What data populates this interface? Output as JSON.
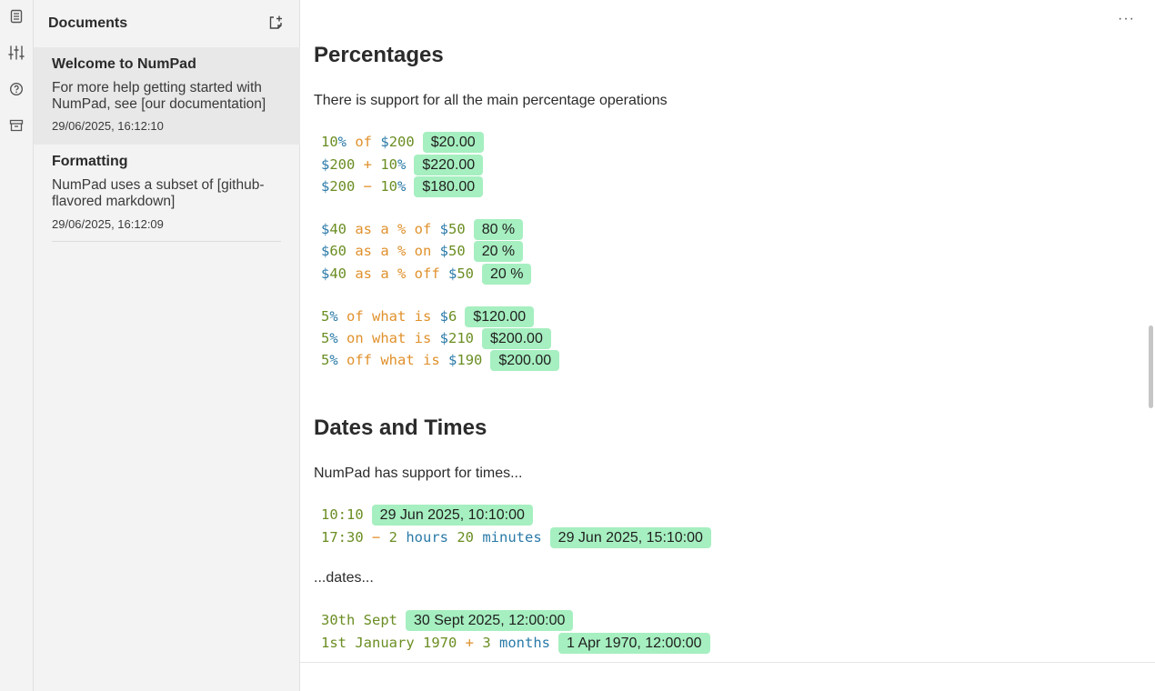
{
  "sidebar": {
    "title": "Documents",
    "documents": [
      {
        "title": "Welcome to NumPad",
        "preview": "For more help getting started with NumPad, see [our documentation]",
        "date": "29/06/2025, 16:12:10"
      },
      {
        "title": "Formatting",
        "preview": "NumPad uses a subset of [github-flavored markdown]",
        "date": "29/06/2025, 16:12:09"
      }
    ]
  },
  "rail_icons": [
    "document-icon",
    "sliders-icon",
    "help-icon",
    "archive-icon"
  ],
  "editor": {
    "more_label": "···",
    "sections": [
      {
        "heading": "Percentages",
        "intro": "There is support for all the main percentage operations",
        "lines": [
          {
            "tokens": [
              [
                "num",
                "10"
              ],
              [
                "unit",
                "%"
              ],
              [
                "kw",
                " of "
              ],
              [
                "unit",
                "$"
              ],
              [
                "num",
                "200"
              ]
            ],
            "result": "$20.00"
          },
          {
            "tokens": [
              [
                "unit",
                "$"
              ],
              [
                "num",
                "200"
              ],
              [
                "op",
                " + "
              ],
              [
                "num",
                "10"
              ],
              [
                "unit",
                "%"
              ]
            ],
            "result": "$220.00"
          },
          {
            "tokens": [
              [
                "unit",
                "$"
              ],
              [
                "num",
                "200"
              ],
              [
                "op",
                " − "
              ],
              [
                "num",
                "10"
              ],
              [
                "unit",
                "%"
              ]
            ],
            "result": "$180.00"
          },
          {
            "tokens": [
              [
                "unit",
                "$"
              ],
              [
                "num",
                "40"
              ],
              [
                "kw",
                " as a % of "
              ],
              [
                "unit",
                "$"
              ],
              [
                "num",
                "50"
              ]
            ],
            "result": "80 %"
          },
          {
            "tokens": [
              [
                "unit",
                "$"
              ],
              [
                "num",
                "60"
              ],
              [
                "kw",
                " as a % on "
              ],
              [
                "unit",
                "$"
              ],
              [
                "num",
                "50"
              ]
            ],
            "result": "20 %"
          },
          {
            "tokens": [
              [
                "unit",
                "$"
              ],
              [
                "num",
                "40"
              ],
              [
                "kw",
                " as a % off "
              ],
              [
                "unit",
                "$"
              ],
              [
                "num",
                "50"
              ]
            ],
            "result": "20 %"
          },
          {
            "tokens": [
              [
                "num",
                "5"
              ],
              [
                "unit",
                "%"
              ],
              [
                "kw",
                " of what is "
              ],
              [
                "unit",
                "$"
              ],
              [
                "num",
                "6"
              ]
            ],
            "result": "$120.00"
          },
          {
            "tokens": [
              [
                "num",
                "5"
              ],
              [
                "unit",
                "%"
              ],
              [
                "kw",
                " on what is "
              ],
              [
                "unit",
                "$"
              ],
              [
                "num",
                "210"
              ]
            ],
            "result": "$200.00"
          },
          {
            "tokens": [
              [
                "num",
                "5"
              ],
              [
                "unit",
                "%"
              ],
              [
                "kw",
                " off what is "
              ],
              [
                "unit",
                "$"
              ],
              [
                "num",
                "190"
              ]
            ],
            "result": "$200.00"
          }
        ]
      },
      {
        "heading": "Dates and Times",
        "intro": "NumPad has support for times...",
        "lines": [
          {
            "tokens": [
              [
                "num",
                "10:10"
              ]
            ],
            "result": "29 Jun 2025, 10:10:00"
          },
          {
            "tokens": [
              [
                "num",
                "17:30"
              ],
              [
                "op",
                " − "
              ],
              [
                "num",
                "2"
              ],
              [
                "unit",
                " hours "
              ],
              [
                "num",
                "20"
              ],
              [
                "unit",
                " minutes"
              ]
            ],
            "result": "29 Jun 2025, 15:10:00"
          }
        ],
        "note": "...dates...",
        "lines2": [
          {
            "tokens": [
              [
                "num",
                "30th Sept"
              ]
            ],
            "result": "30 Sept 2025, 12:00:00"
          },
          {
            "tokens": [
              [
                "num",
                "1st January 1970"
              ],
              [
                "op",
                " + "
              ],
              [
                "num",
                "3"
              ],
              [
                "unit",
                " months"
              ]
            ],
            "result": "1 Apr 1970, 12:00:00"
          }
        ]
      }
    ]
  }
}
